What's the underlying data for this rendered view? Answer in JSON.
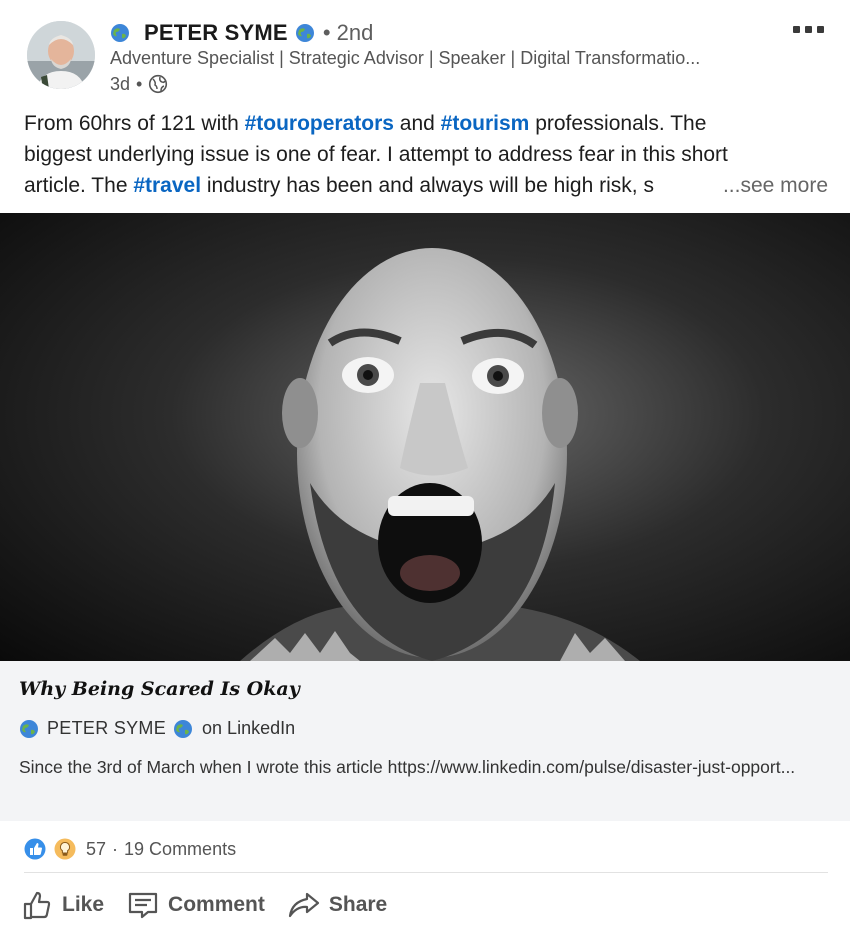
{
  "post": {
    "author_name": "PETER SYME",
    "degree": "2nd",
    "headline": "Adventure Specialist | Strategic Advisor | Speaker | Digital Transformatio...",
    "age": "3d",
    "text_lines": [
      [
        {
          "t": "From 60hrs of 121 with "
        },
        {
          "t": "#touroperators",
          "tag": true
        },
        {
          "t": " and "
        },
        {
          "t": "#tourism",
          "tag": true
        },
        {
          "t": " professionals. The"
        }
      ],
      [
        {
          "t": "biggest underlying issue is one of fear. I attempt to address fear in this short"
        }
      ],
      [
        {
          "t": "article. The "
        },
        {
          "t": "#travel",
          "tag": true
        },
        {
          "t": " industry has been and always will be high risk, s"
        }
      ]
    ],
    "see_more": "...see more"
  },
  "article": {
    "title": "Why Being Scared Is Okay",
    "author": "PETER SYME",
    "source": "on LinkedIn",
    "description": "Since the 3rd of March when I wrote this article https://www.linkedin.com/pulse/disaster-just-opport..."
  },
  "social": {
    "reaction_count": "57",
    "separator": "·",
    "comments": "19 Comments"
  },
  "actions": {
    "like": "Like",
    "comment": "Comment",
    "share": "Share"
  },
  "icons": {
    "globe": "globe-emoji-icon",
    "visibility": "public-globe-icon",
    "more": "more-options-icon",
    "like_reaction": "like-reaction-icon",
    "insight_reaction": "insightful-reaction-icon",
    "like_action": "thumbs-up-icon",
    "comment_action": "comment-icon",
    "share_action": "share-arrow-icon"
  },
  "colors": {
    "hashtag": "#0a66c2",
    "like_blue": "#378fe9",
    "insight_yellow": "#f5bb5c",
    "card_bg": "#f3f4f6"
  }
}
